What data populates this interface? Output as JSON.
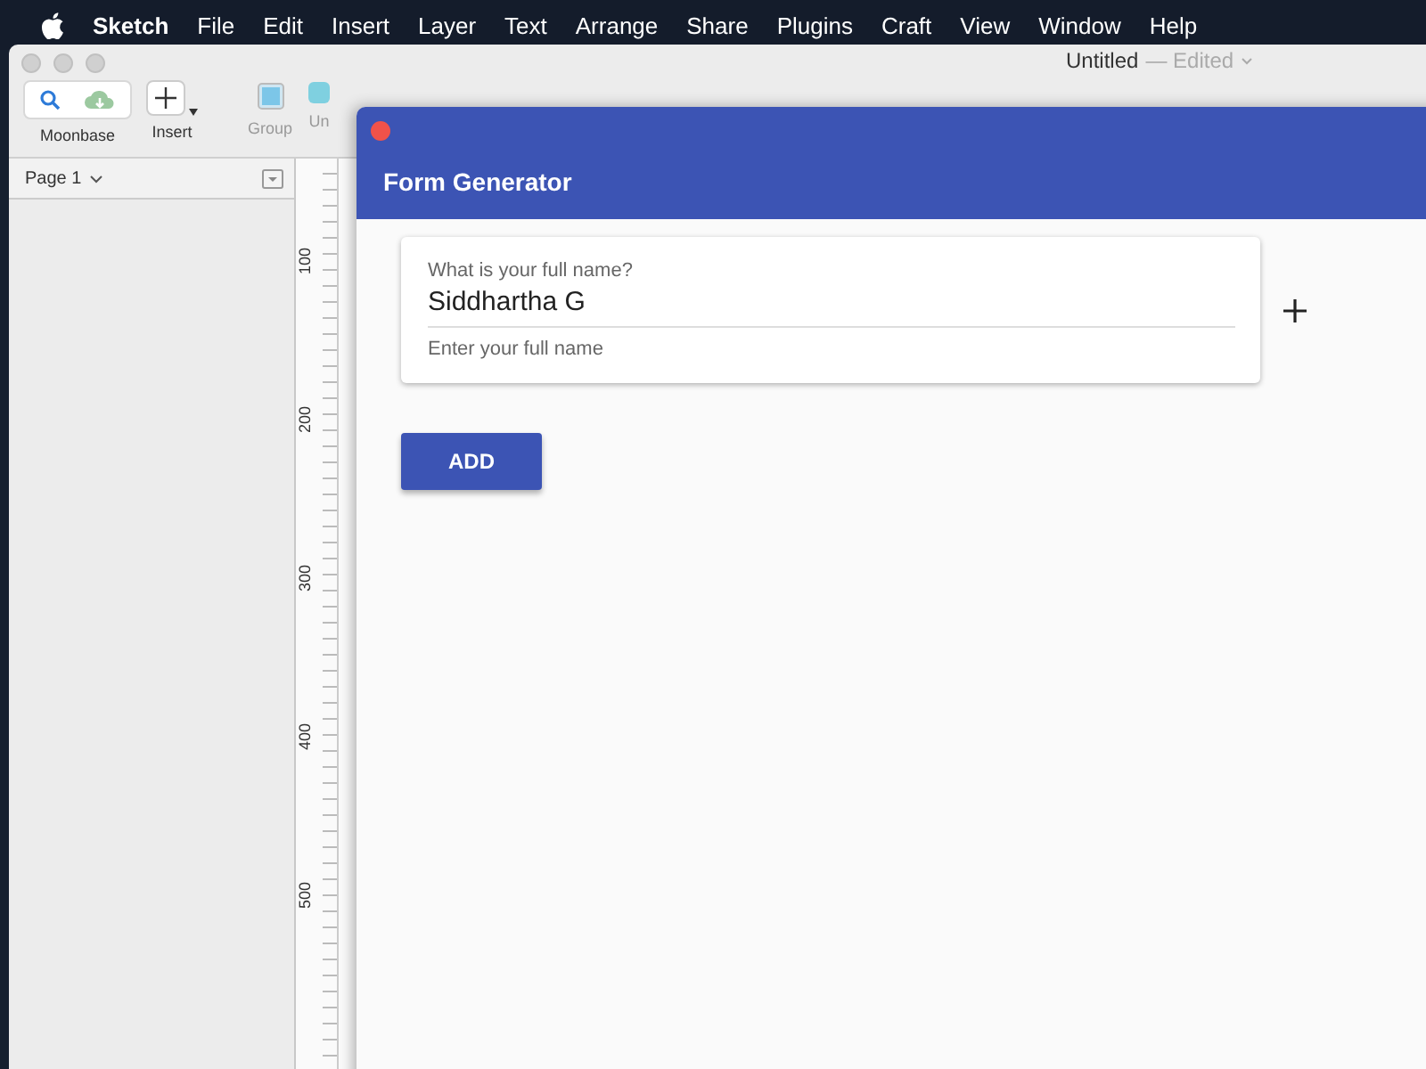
{
  "menu_bar": {
    "app": "Sketch",
    "items": [
      "File",
      "Edit",
      "Insert",
      "Layer",
      "Text",
      "Arrange",
      "Share",
      "Plugins",
      "Craft",
      "View",
      "Window",
      "Help"
    ]
  },
  "window": {
    "title": "Untitled",
    "status": "— Edited"
  },
  "toolbar": {
    "moonbase": "Moonbase",
    "insert": "Insert",
    "group": "Group",
    "ungroup": "Un"
  },
  "sidebar": {
    "page": "Page 1"
  },
  "ruler": {
    "labels": [
      "100",
      "200",
      "300",
      "400",
      "500"
    ]
  },
  "form_window": {
    "title": "Form Generator",
    "fields": [
      {
        "label": "What is your full name?",
        "value": "Siddhartha G",
        "helper": "Enter your full name"
      }
    ],
    "add_button": "ADD"
  }
}
